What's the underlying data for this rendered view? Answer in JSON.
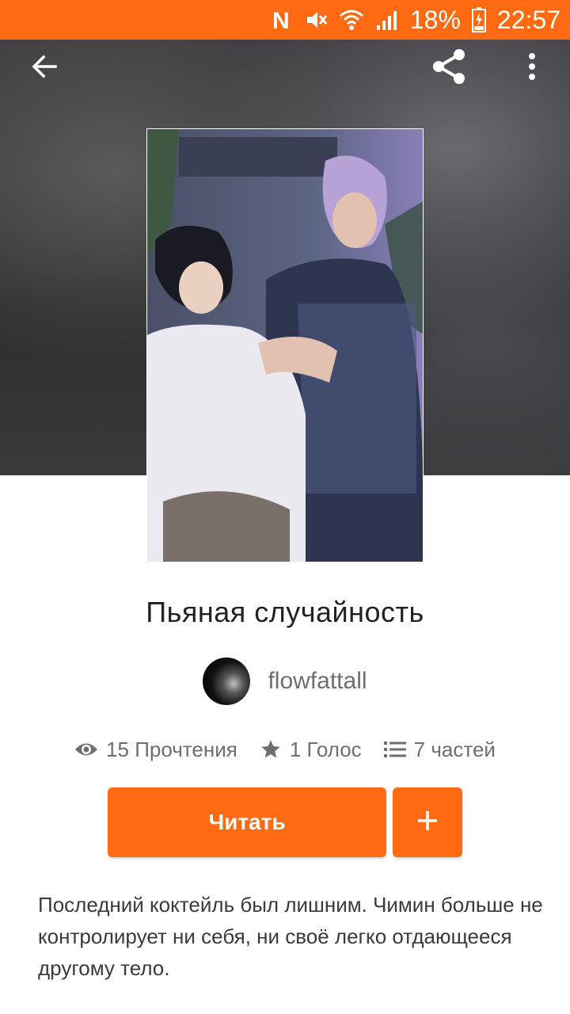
{
  "status_bar": {
    "battery": "18%",
    "time": "22:57",
    "icons": [
      "n-notification-icon",
      "mute-icon",
      "wifi-icon",
      "signal-icon",
      "battery-charging-icon"
    ]
  },
  "toolbar": {
    "back_icon": "arrow-left-icon",
    "share_icon": "share-icon",
    "more_icon": "more-vertical-icon"
  },
  "story": {
    "title": "Пьяная случайность",
    "author": "flowfattall",
    "stats": {
      "reads": "15 Прочтения",
      "votes": "1 Голос",
      "parts": "7 частей"
    },
    "read_button_label": "Читать",
    "add_button_label": "+",
    "description": "Последний коктейль был лишним. Чимин больше не контролирует ни себя, ни своё легко отдающееся другому тело."
  },
  "colors": {
    "accent": "#ff6a12",
    "hero_background": "#3a3a3c",
    "text_primary": "#222222",
    "text_secondary": "#6e6e6e"
  }
}
